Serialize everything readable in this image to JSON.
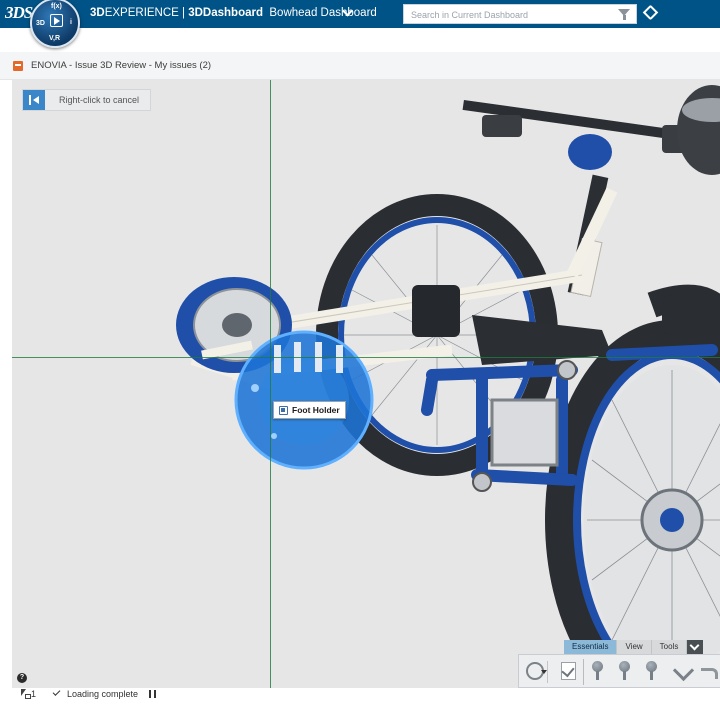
{
  "topbar": {
    "compass": {
      "quadrant_top": "f(x)",
      "quadrant_left": "3D",
      "quadrant_right": "i",
      "quadrant_bottom": "V,R",
      "icon": "compass-play-icon"
    },
    "brand_prefix": "3D",
    "brand_experience": "EXPERIENCE | ",
    "brand_app": "3DDashboard",
    "dashboard_name": "Bowhead Dashboard",
    "search_placeholder": "Search in Current Dashboard"
  },
  "widget": {
    "title": "ENOVIA - Issue 3D Review - My issues (2)"
  },
  "viewer": {
    "cancel_hint": "Right-click to cancel",
    "part_label": "Foot Holder",
    "accent_color": "#1e6fd0"
  },
  "actionbar": {
    "tabs": [
      {
        "label": "Essentials",
        "active": true
      },
      {
        "label": "View",
        "active": false
      },
      {
        "label": "Tools",
        "active": false
      }
    ]
  },
  "status": {
    "help": "?",
    "selection_count": "1",
    "loading_text": "Loading complete"
  },
  "colors": {
    "topbar": "#005386",
    "frame_blue": "#1f4fa8",
    "tire": "#2a2d31",
    "highlight": "#1e74d6"
  }
}
